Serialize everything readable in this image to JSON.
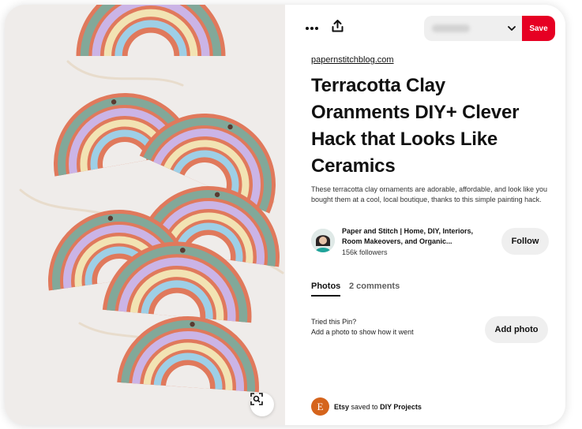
{
  "pin": {
    "source_link": "papernstitchblog.com",
    "title": "Terracotta Clay Oranments DIY+ Clever Hack that Looks Like Ceramics",
    "description": "These terracotta clay ornaments are adorable, affordable, and look like you bought them at a cool, local boutique, thanks to this simple painting hack."
  },
  "toolbar": {
    "more_icon": "more-options-icon",
    "share_icon": "share-upload-icon",
    "board_select_value": "",
    "save_label": "Save"
  },
  "author": {
    "name": "Paper and Stitch | Home, DIY, Interiors, Room Makeovers, and Organic...",
    "followers": "156k followers",
    "follow_label": "Follow"
  },
  "tabs": {
    "photos": "Photos",
    "comments": "2 comments"
  },
  "tried": {
    "line1": "Tried this Pin?",
    "line2": "Add a photo to show how it went",
    "button": "Add photo"
  },
  "saved_by": {
    "logo_letter": "E",
    "user": "Etsy",
    "verb": "saved to",
    "board": "DIY Projects"
  },
  "colors": {
    "save_red": "#e60023",
    "button_gray": "#efefef",
    "etsy_orange": "#d5641c",
    "terracotta": "#e0795c",
    "sage": "#82a899",
    "lavender": "#cbb4e6",
    "cream": "#f2e3b3",
    "sky": "#9ecfe6"
  }
}
